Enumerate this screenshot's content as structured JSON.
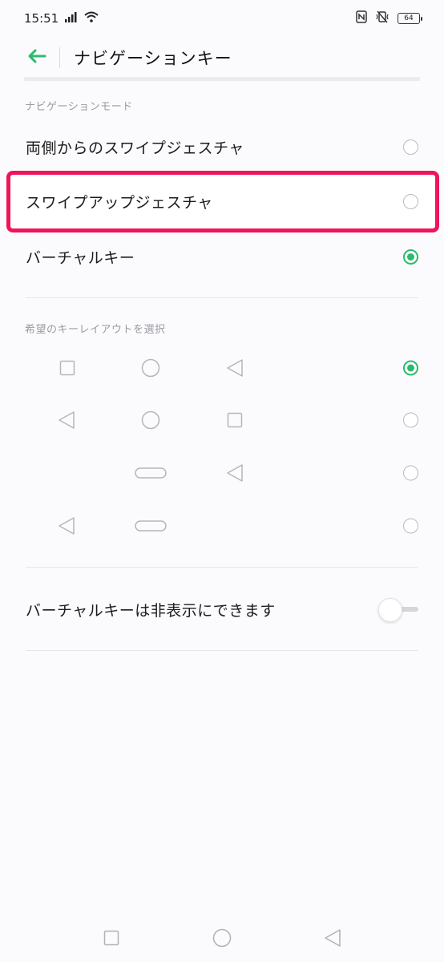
{
  "status_bar": {
    "time": "15:51",
    "battery": "64",
    "icons": [
      "signal-icon",
      "wifi-icon",
      "nfc-icon",
      "vibrate-icon",
      "battery-icon"
    ]
  },
  "header": {
    "title": "ナビゲーションキー",
    "back_icon": "back-arrow-icon"
  },
  "navigation_mode": {
    "section_label": "ナビゲーションモード",
    "options": [
      {
        "label": "両側からのスワイプジェスチャ",
        "selected": false
      },
      {
        "label": "スワイプアップジェスチャ",
        "selected": false
      },
      {
        "label": "バーチャルキー",
        "selected": true
      }
    ]
  },
  "key_layout": {
    "section_label": "希望のキーレイアウトを選択",
    "layouts": [
      {
        "keys": [
          "square-icon",
          "circle-icon",
          "triangle-icon"
        ],
        "selected": true
      },
      {
        "keys": [
          "triangle-icon",
          "circle-icon",
          "square-icon"
        ],
        "selected": false
      },
      {
        "keys": [
          "pill-icon",
          "triangle-icon"
        ],
        "selected": false
      },
      {
        "keys": [
          "triangle-icon",
          "pill-icon"
        ],
        "selected": false
      }
    ]
  },
  "hide_keys": {
    "label": "バーチャルキーは非表示にできます",
    "enabled": false
  },
  "colors": {
    "accent": "#2bbb6f",
    "highlight": "#f0145a"
  }
}
